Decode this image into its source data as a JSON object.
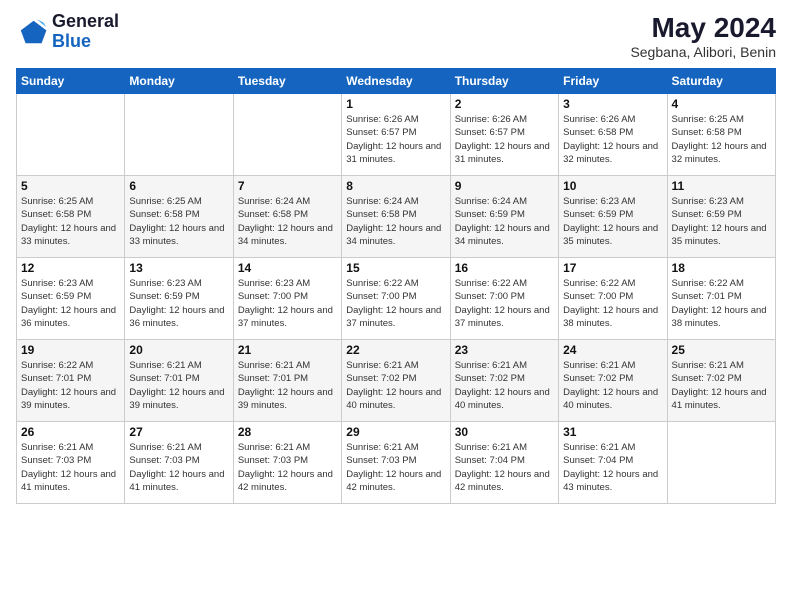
{
  "header": {
    "logo_line1": "General",
    "logo_line2": "Blue",
    "month_year": "May 2024",
    "location": "Segbana, Alibori, Benin"
  },
  "weekdays": [
    "Sunday",
    "Monday",
    "Tuesday",
    "Wednesday",
    "Thursday",
    "Friday",
    "Saturday"
  ],
  "weeks": [
    [
      {
        "day": "",
        "info": ""
      },
      {
        "day": "",
        "info": ""
      },
      {
        "day": "",
        "info": ""
      },
      {
        "day": "1",
        "info": "Sunrise: 6:26 AM\nSunset: 6:57 PM\nDaylight: 12 hours and 31 minutes."
      },
      {
        "day": "2",
        "info": "Sunrise: 6:26 AM\nSunset: 6:57 PM\nDaylight: 12 hours and 31 minutes."
      },
      {
        "day": "3",
        "info": "Sunrise: 6:26 AM\nSunset: 6:58 PM\nDaylight: 12 hours and 32 minutes."
      },
      {
        "day": "4",
        "info": "Sunrise: 6:25 AM\nSunset: 6:58 PM\nDaylight: 12 hours and 32 minutes."
      }
    ],
    [
      {
        "day": "5",
        "info": "Sunrise: 6:25 AM\nSunset: 6:58 PM\nDaylight: 12 hours and 33 minutes."
      },
      {
        "day": "6",
        "info": "Sunrise: 6:25 AM\nSunset: 6:58 PM\nDaylight: 12 hours and 33 minutes."
      },
      {
        "day": "7",
        "info": "Sunrise: 6:24 AM\nSunset: 6:58 PM\nDaylight: 12 hours and 34 minutes."
      },
      {
        "day": "8",
        "info": "Sunrise: 6:24 AM\nSunset: 6:58 PM\nDaylight: 12 hours and 34 minutes."
      },
      {
        "day": "9",
        "info": "Sunrise: 6:24 AM\nSunset: 6:59 PM\nDaylight: 12 hours and 34 minutes."
      },
      {
        "day": "10",
        "info": "Sunrise: 6:23 AM\nSunset: 6:59 PM\nDaylight: 12 hours and 35 minutes."
      },
      {
        "day": "11",
        "info": "Sunrise: 6:23 AM\nSunset: 6:59 PM\nDaylight: 12 hours and 35 minutes."
      }
    ],
    [
      {
        "day": "12",
        "info": "Sunrise: 6:23 AM\nSunset: 6:59 PM\nDaylight: 12 hours and 36 minutes."
      },
      {
        "day": "13",
        "info": "Sunrise: 6:23 AM\nSunset: 6:59 PM\nDaylight: 12 hours and 36 minutes."
      },
      {
        "day": "14",
        "info": "Sunrise: 6:23 AM\nSunset: 7:00 PM\nDaylight: 12 hours and 37 minutes."
      },
      {
        "day": "15",
        "info": "Sunrise: 6:22 AM\nSunset: 7:00 PM\nDaylight: 12 hours and 37 minutes."
      },
      {
        "day": "16",
        "info": "Sunrise: 6:22 AM\nSunset: 7:00 PM\nDaylight: 12 hours and 37 minutes."
      },
      {
        "day": "17",
        "info": "Sunrise: 6:22 AM\nSunset: 7:00 PM\nDaylight: 12 hours and 38 minutes."
      },
      {
        "day": "18",
        "info": "Sunrise: 6:22 AM\nSunset: 7:01 PM\nDaylight: 12 hours and 38 minutes."
      }
    ],
    [
      {
        "day": "19",
        "info": "Sunrise: 6:22 AM\nSunset: 7:01 PM\nDaylight: 12 hours and 39 minutes."
      },
      {
        "day": "20",
        "info": "Sunrise: 6:21 AM\nSunset: 7:01 PM\nDaylight: 12 hours and 39 minutes."
      },
      {
        "day": "21",
        "info": "Sunrise: 6:21 AM\nSunset: 7:01 PM\nDaylight: 12 hours and 39 minutes."
      },
      {
        "day": "22",
        "info": "Sunrise: 6:21 AM\nSunset: 7:02 PM\nDaylight: 12 hours and 40 minutes."
      },
      {
        "day": "23",
        "info": "Sunrise: 6:21 AM\nSunset: 7:02 PM\nDaylight: 12 hours and 40 minutes."
      },
      {
        "day": "24",
        "info": "Sunrise: 6:21 AM\nSunset: 7:02 PM\nDaylight: 12 hours and 40 minutes."
      },
      {
        "day": "25",
        "info": "Sunrise: 6:21 AM\nSunset: 7:02 PM\nDaylight: 12 hours and 41 minutes."
      }
    ],
    [
      {
        "day": "26",
        "info": "Sunrise: 6:21 AM\nSunset: 7:03 PM\nDaylight: 12 hours and 41 minutes."
      },
      {
        "day": "27",
        "info": "Sunrise: 6:21 AM\nSunset: 7:03 PM\nDaylight: 12 hours and 41 minutes."
      },
      {
        "day": "28",
        "info": "Sunrise: 6:21 AM\nSunset: 7:03 PM\nDaylight: 12 hours and 42 minutes."
      },
      {
        "day": "29",
        "info": "Sunrise: 6:21 AM\nSunset: 7:03 PM\nDaylight: 12 hours and 42 minutes."
      },
      {
        "day": "30",
        "info": "Sunrise: 6:21 AM\nSunset: 7:04 PM\nDaylight: 12 hours and 42 minutes."
      },
      {
        "day": "31",
        "info": "Sunrise: 6:21 AM\nSunset: 7:04 PM\nDaylight: 12 hours and 43 minutes."
      },
      {
        "day": "",
        "info": ""
      }
    ]
  ]
}
